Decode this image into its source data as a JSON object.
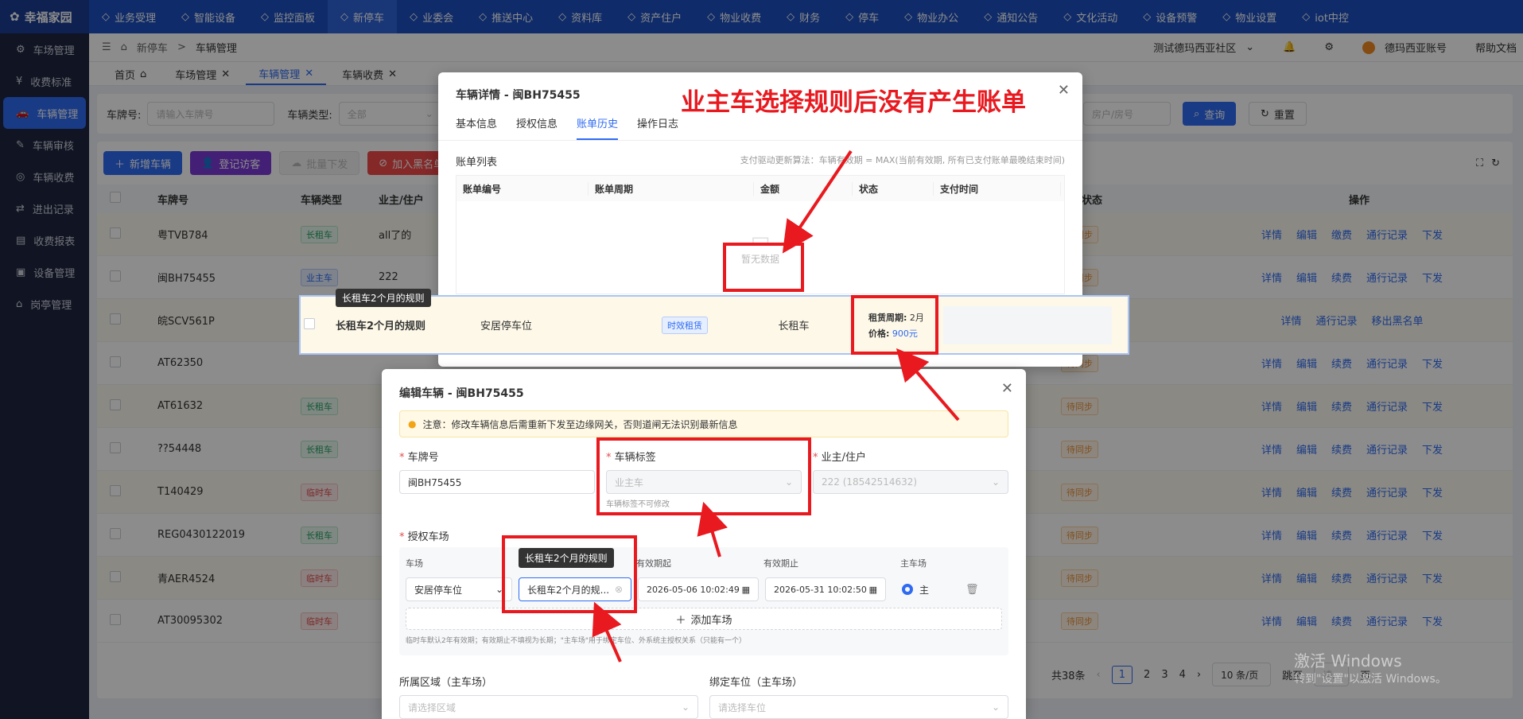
{
  "app": {
    "logo": "幸福家园"
  },
  "sidebar": {
    "items": [
      {
        "icon": "gear-icon",
        "label": "车场管理"
      },
      {
        "icon": "fee-icon",
        "label": "收费标准"
      },
      {
        "icon": "car-icon",
        "label": "车辆管理"
      },
      {
        "icon": "review-icon",
        "label": "车辆审核"
      },
      {
        "icon": "money-icon",
        "label": "车辆收费"
      },
      {
        "icon": "log-icon",
        "label": "进出记录"
      },
      {
        "icon": "report-icon",
        "label": "收费报表"
      },
      {
        "icon": "device-icon",
        "label": "设备管理"
      },
      {
        "icon": "booth-icon",
        "label": "岗亭管理"
      }
    ]
  },
  "topnav": {
    "items": [
      "业务受理",
      "智能设备",
      "监控面板",
      "新停车",
      "业委会",
      "推送中心",
      "资料库",
      "资产住户",
      "物业收费",
      "财务",
      "停车",
      "物业办公",
      "通知公告",
      "文化活动",
      "设备预警",
      "物业设置",
      "iot中控"
    ]
  },
  "header": {
    "breadcrumb_root": "新停车",
    "breadcrumb_sep": ">",
    "breadcrumb_current": "车辆管理",
    "community": "测试德玛西亚社区",
    "account": "德玛西亚账号",
    "help": "帮助文档"
  },
  "tabs": [
    {
      "label": "首页"
    },
    {
      "label": "车场管理"
    },
    {
      "label": "车辆管理"
    },
    {
      "label": "车辆收费"
    }
  ],
  "filters": {
    "plate_label": "车牌号:",
    "plate_placeholder": "请输入车牌号",
    "type_label": "车辆类型:",
    "type_value": "全部",
    "room_placeholder": "房户/房号",
    "search": "查询",
    "reset": "重置"
  },
  "toolbar": {
    "add": "新增车辆",
    "visitor": "登记访客",
    "batch": "批量下发",
    "blacklist": "加入黑名单"
  },
  "table": {
    "headers": [
      "车牌号",
      "车辆类型",
      "业主/住户",
      "同步状态",
      "操作"
    ],
    "rows": [
      {
        "plate": "粤TVB784",
        "type": "长租车",
        "owner": "all了的",
        "sync": "待同步",
        "ops": [
          "详情",
          "编辑",
          "缴费",
          "通行记录",
          "下发"
        ]
      },
      {
        "plate": "闽BH75455",
        "type": "业主车",
        "owner": "222",
        "sync": "待同步",
        "ops": [
          "详情",
          "编辑",
          "续费",
          "通行记录",
          "下发"
        ]
      },
      {
        "plate": "皖SCV561P",
        "type": "",
        "owner": "",
        "sync": "",
        "ops": [
          "详情",
          "通行记录",
          "移出黑名单"
        ]
      },
      {
        "plate": "AT62350",
        "type": "",
        "owner": "",
        "sync": "待同步",
        "ops": [
          "详情",
          "编辑",
          "续费",
          "通行记录",
          "下发"
        ]
      },
      {
        "plate": "AT61632",
        "type": "长租车",
        "owner": "",
        "sync": "待同步",
        "ops": [
          "详情",
          "编辑",
          "续费",
          "通行记录",
          "下发"
        ]
      },
      {
        "plate": "??54448",
        "type": "长租车",
        "owner": "",
        "sync": "待同步",
        "ops": [
          "详情",
          "编辑",
          "续费",
          "通行记录",
          "下发"
        ]
      },
      {
        "plate": "T140429",
        "type": "临时车",
        "owner": "",
        "sync": "待同步",
        "ops": [
          "详情",
          "编辑",
          "续费",
          "通行记录",
          "下发"
        ]
      },
      {
        "plate": "REG0430122019",
        "type": "长租车",
        "owner": "",
        "sync": "待同步",
        "ops": [
          "详情",
          "编辑",
          "续费",
          "通行记录",
          "下发"
        ]
      },
      {
        "plate": "青AER4524",
        "type": "临时车",
        "owner": "",
        "sync": "待同步",
        "ops": [
          "详情",
          "编辑",
          "续费",
          "通行记录",
          "下发"
        ]
      },
      {
        "plate": "AT30095302",
        "type": "临时车",
        "owner": "",
        "sync": "待同步",
        "ops": [
          "详情",
          "编辑",
          "续费",
          "通行记录",
          "下发"
        ]
      }
    ]
  },
  "pagination": {
    "total": "共38条",
    "pages": [
      "1",
      "2",
      "3",
      "4"
    ],
    "per_page": "10 条/页",
    "jump": "跳至",
    "jump_placeholder": "请...",
    "page_unit": "页"
  },
  "detail_modal": {
    "title": "车辆详情 - 闽BH75455",
    "tabs": [
      "基本信息",
      "授权信息",
      "账单历史",
      "操作日志"
    ],
    "bill_list_label": "账单列表",
    "hint": "支付驱动更新算法：车辆有效期 = MAX(当前有效期, 所有已支付账单最晚结束时间)",
    "columns": [
      "账单编号",
      "账单周期",
      "金额",
      "状态",
      "支付时间"
    ],
    "empty": "暂无数据"
  },
  "annotation": "业主车选择规则后没有产生账单",
  "rule_row": {
    "tooltip": "长租车2个月的规则",
    "name": "长租车2个月的规则",
    "lot": "安居停车位",
    "tag": "时效租赁",
    "car_type": "长租车",
    "period_label": "租赁周期:",
    "period_value": "2月",
    "price_label": "价格:",
    "price_value": "900元"
  },
  "edit_modal": {
    "title": "编辑车辆 - 闽BH75455",
    "notice": "注意：修改车辆信息后需重新下发至边缘网关，否则道闸无法识别最新信息",
    "plate_label": "车牌号",
    "plate_value": "闽BH75455",
    "tag_label": "车辆标签",
    "tag_value": "业主车",
    "tag_hint": "车辆标签不可修改",
    "owner_label": "业主/住户",
    "owner_value": "222 (18542514632)",
    "auth_label": "授权车场",
    "auth_cols": [
      "车场",
      "",
      "有效期起",
      "有效期止",
      "主车场"
    ],
    "auth_row": {
      "lot": "安居停车位",
      "rule": "长租车2个月的规...",
      "start": "2026-05-06 10:02:49",
      "end": "2026-05-31 10:02:50",
      "main": "主"
    },
    "rule_tooltip": "长租车2个月的规则",
    "add_lot": "添加车场",
    "auth_note": "临时车默认2年有效期；有效期止不填视为长期；\"主车场\"用于绑定车位、外系统主授权关系（只能有一个）",
    "area_label": "所属区域（主车场）",
    "area_placeholder": "请选择区域",
    "space_label": "绑定车位（主车场）",
    "space_placeholder": "请选择车位"
  },
  "watermark": {
    "line1": "激活 Windows",
    "line2": "转到\"设置\"以激活 Windows。"
  }
}
